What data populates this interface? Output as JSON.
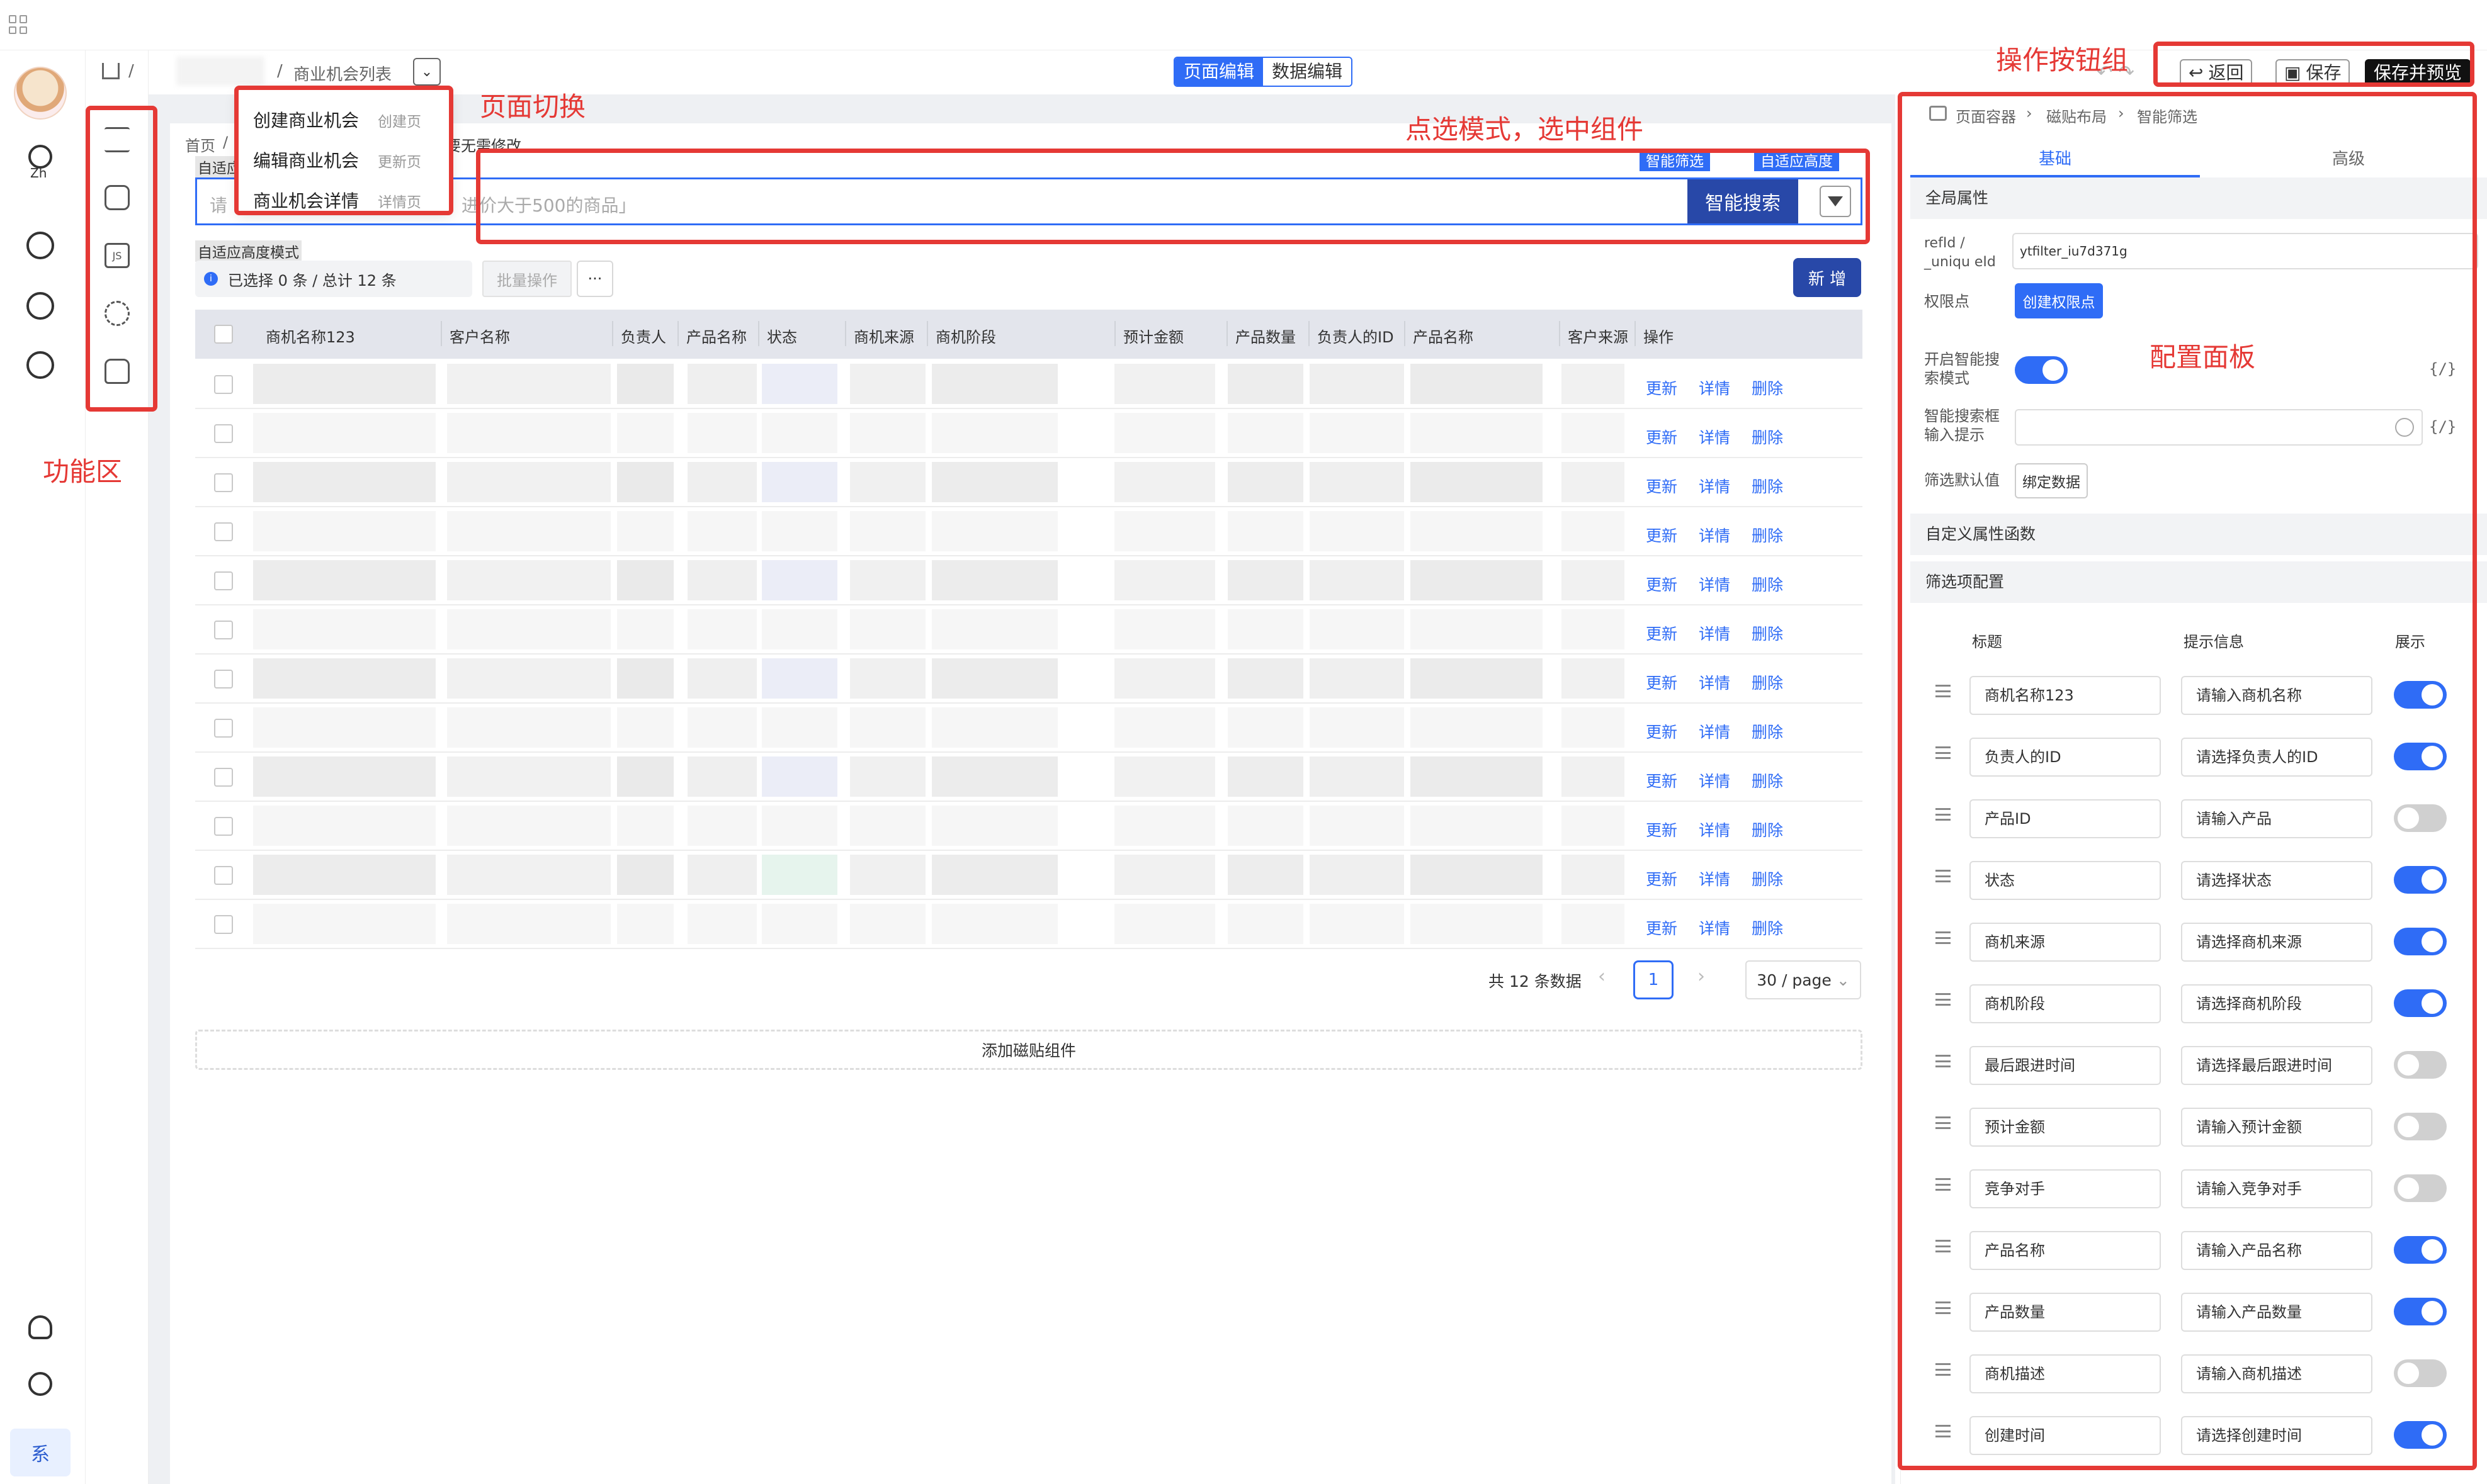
{
  "header": {
    "breadcrumb_sep": "/",
    "page_select": "商业机会列表",
    "mode_tabs": [
      "页面编辑",
      "数据编辑"
    ],
    "buttons": {
      "back": "返回",
      "save": "保存",
      "save_preview": "保存并预览"
    }
  },
  "rail": {
    "lang": "Zh",
    "system_badge": "系"
  },
  "page_switch_menu": [
    {
      "label": "创建商业机会",
      "type": "创建页"
    },
    {
      "label": "编辑商业机会",
      "type": "更新页"
    },
    {
      "label": "商业机会详情",
      "type": "详情页"
    }
  ],
  "canvas": {
    "breadcrumb_home": "首页",
    "breadcrumb_sep": "/",
    "note_fragment": "要无需修改",
    "adaptive_label_1": "自适应",
    "adaptive_label_2": "自适应高度模式",
    "smart_tags": [
      "智能筛选",
      "自适应高度"
    ],
    "search_placeholder_prefix": "请",
    "search_placeholder": "进价大于500的商品」",
    "search_button": "智能搜索",
    "selection_info": "已选择 0 条 / 总计 12 条",
    "batch_button": "批量操作",
    "more_button": "···",
    "new_button": "新 增",
    "columns": [
      "商机名称123",
      "客户名称",
      "负责人",
      "产品名称",
      "状态",
      "商机来源",
      "商机阶段",
      "预计金额",
      "产品数量",
      "负责人的ID",
      "产品名称",
      "客户来源",
      "操作"
    ],
    "row_actions": [
      "更新",
      "详情",
      "删除"
    ],
    "row_count": 12,
    "pagination": {
      "total": "共 12 条数据",
      "current": "1",
      "page_size": "30 / page"
    },
    "add_tile": "添加磁贴组件"
  },
  "right_panel": {
    "breadcrumb": [
      "页面容器",
      "磁贴布局",
      "智能筛选"
    ],
    "tabs": [
      "基础",
      "高级"
    ],
    "section_global": "全局属性",
    "refid_label": "refId / _uniqu eId",
    "refid_value": "ytfilter_iu7d371g",
    "perm_label": "权限点",
    "perm_button": "创建权限点",
    "smart_mode_label": "开启智能搜索模式",
    "smart_tip_label": "智能搜索框输入提示",
    "filter_default_label": "筛选默认值",
    "bind_data_button": "绑定数据",
    "brace": "{/}",
    "section_custom_fn": "自定义属性函数",
    "section_filter_cfg": "筛选项配置",
    "cfg_headers": [
      "标题",
      "提示信息",
      "展示"
    ],
    "cfg_items": [
      {
        "title": "商机名称123",
        "hint": "请输入商机名称",
        "show": true
      },
      {
        "title": "负责人的ID",
        "hint": "请选择负责人的ID",
        "show": true
      },
      {
        "title": "产品ID",
        "hint": "请输入产品",
        "show": false
      },
      {
        "title": "状态",
        "hint": "请选择状态",
        "show": true
      },
      {
        "title": "商机来源",
        "hint": "请选择商机来源",
        "show": true
      },
      {
        "title": "商机阶段",
        "hint": "请选择商机阶段",
        "show": true
      },
      {
        "title": "最后跟进时间",
        "hint": "请选择最后跟进时间",
        "show": false
      },
      {
        "title": "预计金额",
        "hint": "请输入预计金额",
        "show": false
      },
      {
        "title": "竞争对手",
        "hint": "请输入竞争对手",
        "show": false
      },
      {
        "title": "产品名称",
        "hint": "请输入产品名称",
        "show": true
      },
      {
        "title": "产品数量",
        "hint": "请输入产品数量",
        "show": true
      },
      {
        "title": "商机描述",
        "hint": "请输入商机描述",
        "show": false
      },
      {
        "title": "创建时间",
        "hint": "请选择创建时间",
        "show": true
      }
    ]
  },
  "annotations": {
    "function_area": "功能区",
    "page_switch": "页面切换",
    "select_mode": "点选模式，选中组件",
    "button_group": "操作按钮组",
    "config_panel": "配置面板"
  },
  "colors": {
    "accent": "#2f6cf6",
    "annotation": "#e53935",
    "primary_dark": "#2848a8"
  }
}
